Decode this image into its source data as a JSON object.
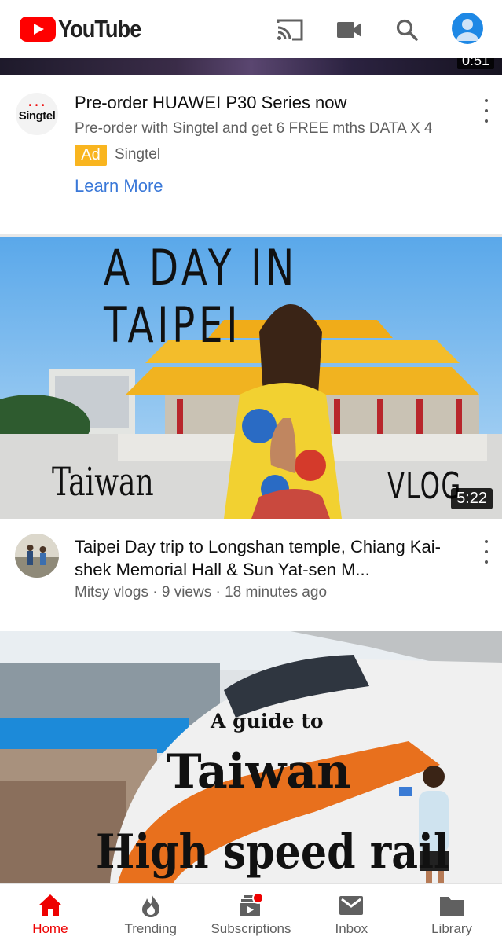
{
  "header": {
    "logo_text": "YouTube",
    "icons": [
      "cast-icon",
      "camera-icon",
      "search-icon",
      "account-avatar"
    ]
  },
  "top_video": {
    "duration": "0:51"
  },
  "ad": {
    "logo_text": "Singtel",
    "title": "Pre-order HUAWEI P30 Series now",
    "description": "Pre-order with Singtel and get 6 FREE mths DATA X 4",
    "badge": "Ad",
    "advertiser": "Singtel",
    "cta": "Learn More"
  },
  "videos": [
    {
      "thumb_text": {
        "headline": "A DAY IN TAIPEI",
        "left": "Taiwan",
        "right": "VLOG"
      },
      "duration": "5:22",
      "title": "Taipei Day trip to Longshan temple, Chiang Kai-shek Memorial Hall & Sun Yat-sen M...",
      "meta": "Mitsy vlogs · 9 views · 18 minutes ago"
    },
    {
      "thumb_text": {
        "line1": "A guide to",
        "line2": "Taiwan",
        "line3": "High speed rail"
      }
    }
  ],
  "nav": [
    {
      "label": "Home",
      "icon": "home-icon",
      "active": true
    },
    {
      "label": "Trending",
      "icon": "trending-icon",
      "active": false
    },
    {
      "label": "Subscriptions",
      "icon": "subscriptions-icon",
      "active": false
    },
    {
      "label": "Inbox",
      "icon": "inbox-icon",
      "active": false
    },
    {
      "label": "Library",
      "icon": "library-icon",
      "active": false
    }
  ],
  "colors": {
    "brand_red": "#ff0000",
    "link_blue": "#3a78d8",
    "ad_badge": "#f9b51f",
    "active_nav": "#ee0000"
  }
}
